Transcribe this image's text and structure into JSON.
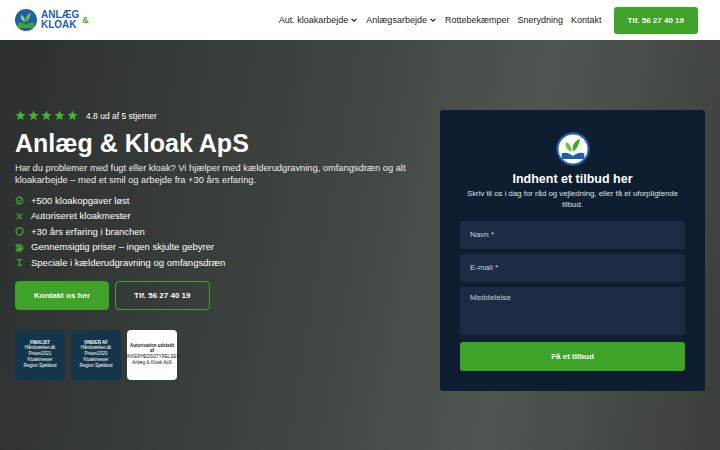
{
  "nav": {
    "logo": {
      "line1": "ANLÆG",
      "amp": "&",
      "line2": "KLOAK"
    },
    "items": [
      {
        "label": "Aut. kloakarbejde",
        "dropdown": true
      },
      {
        "label": "Anlægsarbejde",
        "dropdown": true
      },
      {
        "label": "Rottebekæmper",
        "dropdown": false
      },
      {
        "label": "Snerydning",
        "dropdown": false
      },
      {
        "label": "Kontakt",
        "dropdown": false
      }
    ],
    "phone_button": "Tlf. 56 27 40 19"
  },
  "hero": {
    "rating": {
      "stars": 5,
      "text": "4.8 ud af 5 stjerner"
    },
    "title": "Anlæg & Kloak ApS",
    "intro": "Har du problemer med fugt eller kloak? Vi hjælper med kælderudgravning, omfangsdræn og alt kloakarbejde – med et smil og arbejde fra +30 års erfaring.",
    "features": [
      "+500 kloakopgaver løst",
      "Autoriseret kloakmester",
      "+30 års erfaring i branchen",
      "Gennemsigtig priser – ingen skjulte gebyrer",
      "Speciale i kælderudgravning og omfangsdræn"
    ],
    "buttons": [
      {
        "label": "Kontakt os her",
        "kind": "filled"
      },
      {
        "label": "Tlf. 56 27 40 19",
        "kind": "outline"
      }
    ],
    "badges": [
      {
        "lines": [
          "FINALIST",
          "Håndværker.dk",
          "Prisen2021",
          "Kloakmester",
          "Region Sjælland"
        ],
        "kind": "award"
      },
      {
        "lines": [
          "VINDER AF",
          "Håndværker.dk",
          "Prisen2020",
          "Kloakmester",
          "Region Sjælland"
        ],
        "kind": "award"
      },
      {
        "lines": [
          "Autorisation udstedt af",
          "SIKKERHEDSSTYRELSEN",
          "Anlæg & Kloak ApS"
        ],
        "kind": "authority"
      }
    ]
  },
  "form": {
    "title": "Indhent et tilbud her",
    "description": "Skriv til os i dag for råd og vejledning, eller få et uforpligtende tilbud.",
    "fields": [
      {
        "placeholder": "Navn *",
        "kind": "input"
      },
      {
        "placeholder": "E-mail *",
        "kind": "input"
      },
      {
        "placeholder": "Meddelelse",
        "kind": "textarea"
      }
    ],
    "submit": "Få et tilbud"
  }
}
